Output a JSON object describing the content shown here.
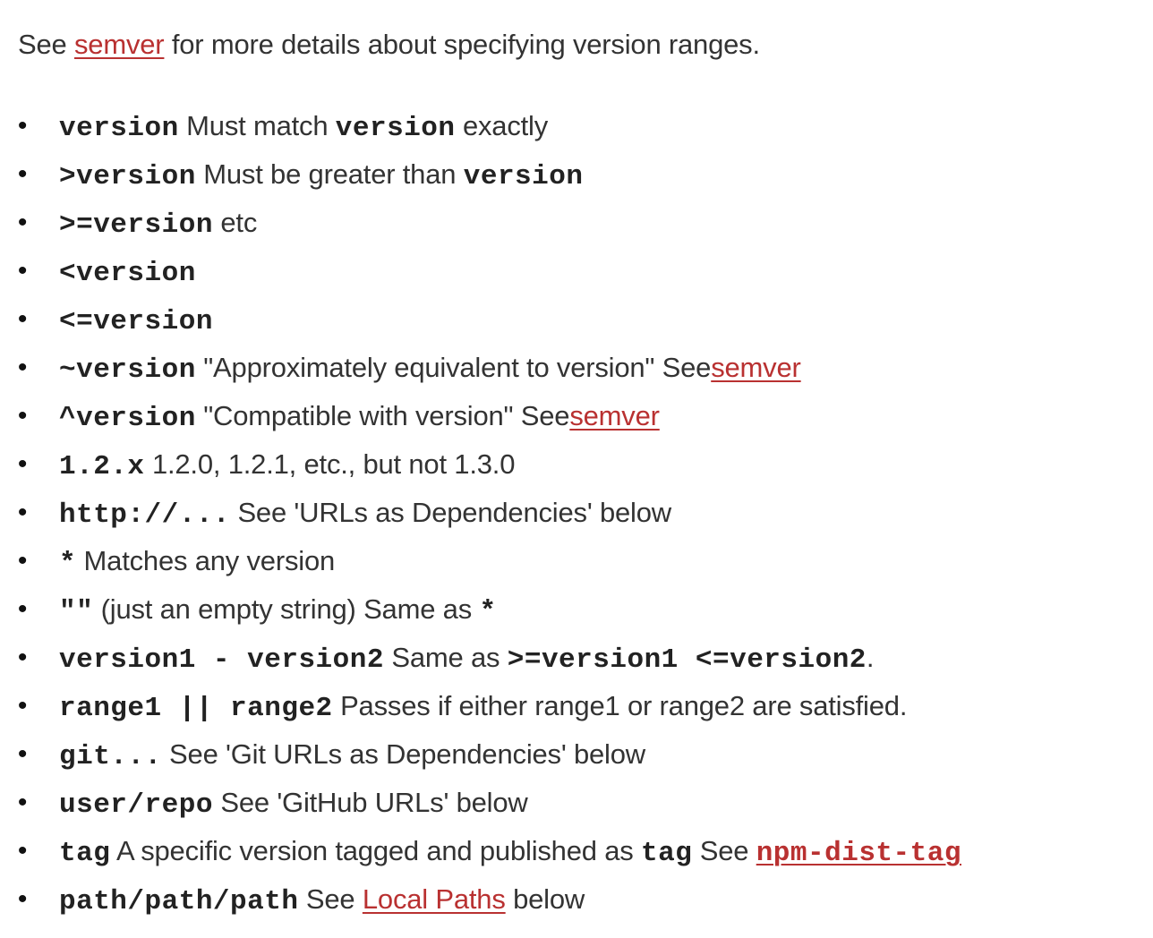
{
  "intro": {
    "see": "See",
    "link": "semver",
    "rest": "for more details about specifying version ranges."
  },
  "items": [
    {
      "code": "version",
      "text1": "Must match",
      "code2": "version",
      "text2": "exactly"
    },
    {
      "code": ">version",
      "text1": "Must be greater than",
      "code2": "version"
    },
    {
      "code": ">=version",
      "text1": "etc"
    },
    {
      "code": "<version"
    },
    {
      "code": "<=version"
    },
    {
      "code": "~version",
      "text1": "\"Approximately equivalent to version\" See",
      "link": "semver"
    },
    {
      "code": "^version",
      "text1": "\"Compatible with version\" See",
      "link": "semver"
    },
    {
      "code": "1.2.x",
      "text1": "1.2.0, 1.2.1, etc., but not 1.3.0"
    },
    {
      "code": "http://...",
      "text1": "See 'URLs as Dependencies' below"
    },
    {
      "code": "*",
      "text1": "Matches any version"
    },
    {
      "code": "\"\"",
      "text1": "(just an empty string) Same as",
      "code2": "*"
    },
    {
      "code": "version1 - version2",
      "text1": "Same as",
      "code2": ">=version1 <=version2",
      "text2": "."
    },
    {
      "code": "range1 || range2",
      "text1": "Passes if either range1 or range2 are satisfied."
    },
    {
      "code": "git...",
      "text1": "See 'Git URLs as Dependencies' below"
    },
    {
      "code": "user/repo",
      "text1": "See 'GitHub URLs' below"
    },
    {
      "code": "tag",
      "text1": "A specific version tagged and published as",
      "code2": "tag",
      "text2": "See",
      "link_code": "npm-dist-tag"
    },
    {
      "code": "path/path/path",
      "text1": "See",
      "link": "Local Paths",
      "text2": "below"
    }
  ],
  "bullet": "•",
  "colors": {
    "text": "#333333",
    "link": "#b93131",
    "code": "#222222"
  }
}
